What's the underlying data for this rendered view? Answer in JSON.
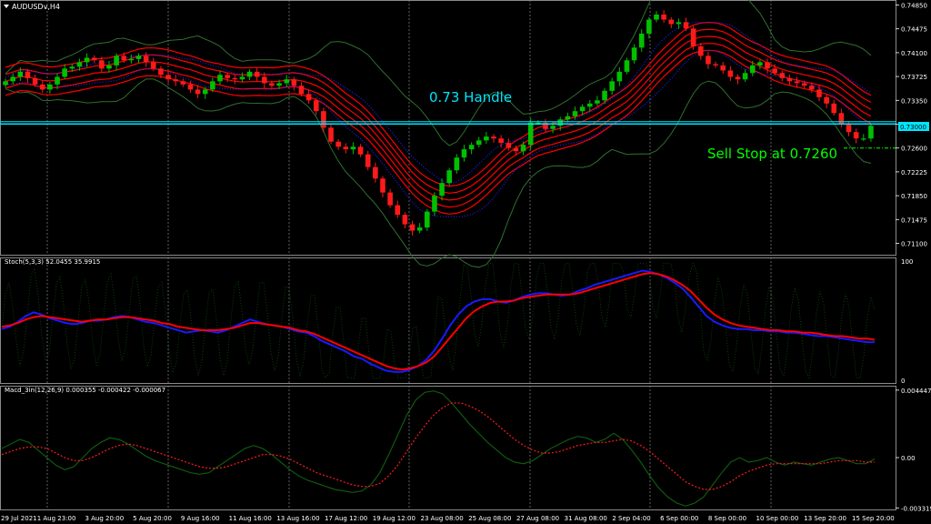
{
  "window": {
    "title": "AUDUSDv,H4"
  },
  "colors": {
    "background": "#000000",
    "grid": "#8a8a8a",
    "bull": "#00c000",
    "bear": "#ff1a1a",
    "env_red": "#ff0000",
    "outer_band": "#2f6f2f",
    "inner_dot": "#2020ff",
    "handle_line": "#00e5ff",
    "sell_stop": "#00ff00",
    "stoch_main": "#1a1aff",
    "stoch_signal": "#ff0000",
    "stoch_fast": "#0f4f0f",
    "macd_main": "#0f5a0f",
    "macd_signal": "#ff1a1a"
  },
  "annotations": {
    "handle_text": "0.73 Handle",
    "sell_stop_text": "Sell Stop at 0.7260",
    "handle_price_tag": "0.73000"
  },
  "chart_data": [
    {
      "type": "candlestick",
      "title": "AUDUSDv,H4",
      "ylim": [
        0.7095,
        0.749
      ],
      "y_ticks": [
        "0.74850",
        "0.74475",
        "0.74100",
        "0.73725",
        "0.73350",
        "0.72975",
        "0.72600",
        "0.72225",
        "0.71850",
        "0.71475",
        "0.71100"
      ],
      "x_ticks": [
        "29 Jul 2021",
        "1 Aug 23:00",
        "3 Aug 20:00",
        "5 Aug 20:00",
        "9 Aug 16:00",
        "11 Aug 16:00",
        "13 Aug 16:00",
        "17 Aug 12:00",
        "19 Aug 12:00",
        "23 Aug 08:00",
        "25 Aug 08:00",
        "27 Aug 08:00",
        "31 Aug 08:00",
        "2 Sep 04:00",
        "6 Sep 00:00",
        "8 Sep 00:00",
        "10 Sep 00:00",
        "13 Sep 20:00",
        "15 Sep 20:00"
      ],
      "close_series": [
        0.7365,
        0.7372,
        0.738,
        0.737,
        0.736,
        0.7352,
        0.736,
        0.7372,
        0.7385,
        0.7388,
        0.7395,
        0.7402,
        0.7398,
        0.7385,
        0.739,
        0.7405,
        0.7398,
        0.74,
        0.7405,
        0.7395,
        0.7385,
        0.7375,
        0.7368,
        0.7365,
        0.736,
        0.7352,
        0.7345,
        0.7352,
        0.7365,
        0.7375,
        0.737,
        0.7368,
        0.7372,
        0.738,
        0.7372,
        0.7362,
        0.7358,
        0.7362,
        0.7368,
        0.7358,
        0.7345,
        0.7335,
        0.7318,
        0.7292,
        0.727,
        0.7262,
        0.7258,
        0.7262,
        0.725,
        0.723,
        0.7212,
        0.719,
        0.717,
        0.7155,
        0.714,
        0.713,
        0.7135,
        0.716,
        0.7185,
        0.7205,
        0.7225,
        0.7245,
        0.7258,
        0.7265,
        0.7272,
        0.7278,
        0.7275,
        0.7268,
        0.726,
        0.7255,
        0.7265,
        0.73,
        0.73,
        0.729,
        0.7295,
        0.7305,
        0.731,
        0.7318,
        0.7325,
        0.733,
        0.7335,
        0.735,
        0.7365,
        0.738,
        0.7398,
        0.7418,
        0.744,
        0.7462,
        0.747,
        0.7462,
        0.7455,
        0.7458,
        0.7448,
        0.742,
        0.7405,
        0.7392,
        0.739,
        0.7382,
        0.7372,
        0.7368,
        0.7378,
        0.739,
        0.7395,
        0.7385,
        0.7378,
        0.737,
        0.7365,
        0.7362,
        0.7358,
        0.7352,
        0.734,
        0.733,
        0.7315,
        0.7298,
        0.7285,
        0.7275,
        0.7275,
        0.7295
      ],
      "horizontal_lines": [
        {
          "value": 0.73,
          "label": "0.73000"
        },
        {
          "value": 0.726,
          "style": "dash-dot"
        }
      ]
    },
    {
      "type": "line",
      "title": "Stoch(5,3,3) 52.0455 35.9915",
      "ylim": [
        0,
        100
      ],
      "y_ticks": [
        "100",
        "0"
      ],
      "series": [
        {
          "role": "main",
          "values": [
            43,
            45,
            49,
            54,
            57,
            55,
            52,
            50,
            48,
            47,
            48,
            50,
            50,
            51,
            53,
            54,
            53,
            51,
            49,
            48,
            46,
            44,
            42,
            40,
            41,
            42,
            41,
            40,
            42,
            45,
            48,
            51,
            49,
            47,
            46,
            45,
            43,
            41,
            40,
            37,
            33,
            30,
            27,
            24,
            20,
            18,
            14,
            11,
            8,
            7,
            7,
            9,
            12,
            17,
            25,
            35,
            46,
            55,
            62,
            66,
            68,
            68,
            66,
            65,
            67,
            70,
            72,
            73,
            73,
            72,
            71,
            72,
            75,
            77,
            80,
            82,
            84,
            86,
            88,
            90,
            92,
            91,
            89,
            86,
            82,
            77,
            70,
            62,
            54,
            49,
            46,
            44,
            43,
            43,
            42,
            42,
            41,
            41,
            40,
            40,
            39,
            38,
            37,
            37,
            36,
            35,
            34,
            33,
            32,
            32
          ]
        },
        {
          "role": "signal",
          "values": [
            45,
            46,
            48,
            51,
            53,
            54,
            53,
            52,
            51,
            50,
            49,
            50,
            51,
            51,
            52,
            53,
            53,
            52,
            51,
            50,
            48,
            47,
            45,
            44,
            43,
            42,
            42,
            42,
            43,
            44,
            46,
            48,
            48,
            47,
            46,
            45,
            44,
            42,
            41,
            39,
            36,
            33,
            30,
            27,
            24,
            21,
            18,
            15,
            12,
            10,
            9,
            10,
            12,
            15,
            20,
            28,
            36,
            44,
            52,
            58,
            62,
            65,
            66,
            66,
            67,
            69,
            70,
            71,
            72,
            72,
            72,
            72,
            73,
            75,
            77,
            79,
            81,
            83,
            85,
            87,
            89,
            90,
            89,
            87,
            84,
            80,
            75,
            68,
            61,
            55,
            51,
            48,
            46,
            45,
            44,
            43,
            42,
            42,
            41,
            41,
            40,
            40,
            39,
            38,
            37,
            37,
            36,
            35,
            35,
            34
          ]
        }
      ]
    },
    {
      "type": "line",
      "title": "Macd_3in(12,26,9) 0.000355 -0.000422 -0.000067",
      "ylim": [
        -0.0033,
        0.0045
      ],
      "y_ticks": [
        "0.004447",
        "0.00",
        "-0.003319"
      ],
      "series": [
        {
          "role": "main",
          "values": [
            0.0006,
            0.0009,
            0.0012,
            0.001,
            0.0005,
            0.0,
            -0.0005,
            -0.0008,
            -0.0006,
            0.0,
            0.0006,
            0.001,
            0.0013,
            0.0012,
            0.0009,
            0.0005,
            0.0001,
            -0.0002,
            -0.0004,
            -0.0006,
            -0.0008,
            -0.001,
            -0.0011,
            -0.001,
            -0.0006,
            -0.0002,
            0.0002,
            0.0006,
            0.0008,
            0.0006,
            0.0002,
            -0.0003,
            -0.0008,
            -0.0012,
            -0.0015,
            -0.0017,
            -0.0019,
            -0.0021,
            -0.0022,
            -0.0023,
            -0.0022,
            -0.0018,
            -0.001,
            0.0002,
            0.0015,
            0.0028,
            0.0038,
            0.0043,
            0.0044,
            0.0042,
            0.0036,
            0.0029,
            0.0022,
            0.0016,
            0.001,
            0.0005,
            0.0,
            -0.0003,
            -0.0004,
            -0.0002,
            0.0002,
            0.0006,
            0.0009,
            0.0012,
            0.0014,
            0.0013,
            0.001,
            0.0012,
            0.0016,
            0.0012,
            0.0005,
            -0.0003,
            -0.0012,
            -0.002,
            -0.0026,
            -0.003,
            -0.0032,
            -0.003,
            -0.0026,
            -0.0018,
            -0.001,
            -0.0003,
            0.0,
            -0.0003,
            -0.0002,
            0.0,
            -0.0003,
            -0.0005,
            -0.0003,
            -0.0004,
            -0.0005,
            -0.0003,
            -0.0001,
            0.0,
            -0.0002,
            -0.0004,
            -0.0004,
            -0.0001
          ]
        },
        {
          "role": "signal",
          "values": [
            0.0002,
            0.0004,
            0.0006,
            0.0007,
            0.0007,
            0.0006,
            0.0003,
            0.0,
            -0.0002,
            -0.0002,
            0.0,
            0.0003,
            0.0006,
            0.0008,
            0.0009,
            0.0008,
            0.0006,
            0.0004,
            0.0002,
            0.0,
            -0.0002,
            -0.0004,
            -0.0006,
            -0.0007,
            -0.0007,
            -0.0006,
            -0.0004,
            -0.0002,
            0.0,
            0.0002,
            0.0002,
            0.0001,
            -0.0001,
            -0.0004,
            -0.0007,
            -0.001,
            -0.0012,
            -0.0014,
            -0.0016,
            -0.0018,
            -0.0019,
            -0.0019,
            -0.0017,
            -0.0012,
            -0.0005,
            0.0004,
            0.0013,
            0.0021,
            0.0028,
            0.0033,
            0.0036,
            0.0036,
            0.0034,
            0.0031,
            0.0027,
            0.0022,
            0.0017,
            0.0012,
            0.0008,
            0.0005,
            0.0003,
            0.0003,
            0.0004,
            0.0006,
            0.0008,
            0.0009,
            0.001,
            0.001,
            0.0011,
            0.0012,
            0.0011,
            0.0008,
            0.0004,
            -0.0001,
            -0.0006,
            -0.0011,
            -0.0016,
            -0.0019,
            -0.0021,
            -0.0021,
            -0.0019,
            -0.0016,
            -0.0012,
            -0.0009,
            -0.0007,
            -0.0005,
            -0.0004,
            -0.0004,
            -0.0004,
            -0.0004,
            -0.0004,
            -0.0004,
            -0.0003,
            -0.0002,
            -0.0002,
            -0.0002,
            -0.0003,
            -0.0003
          ]
        }
      ]
    }
  ]
}
